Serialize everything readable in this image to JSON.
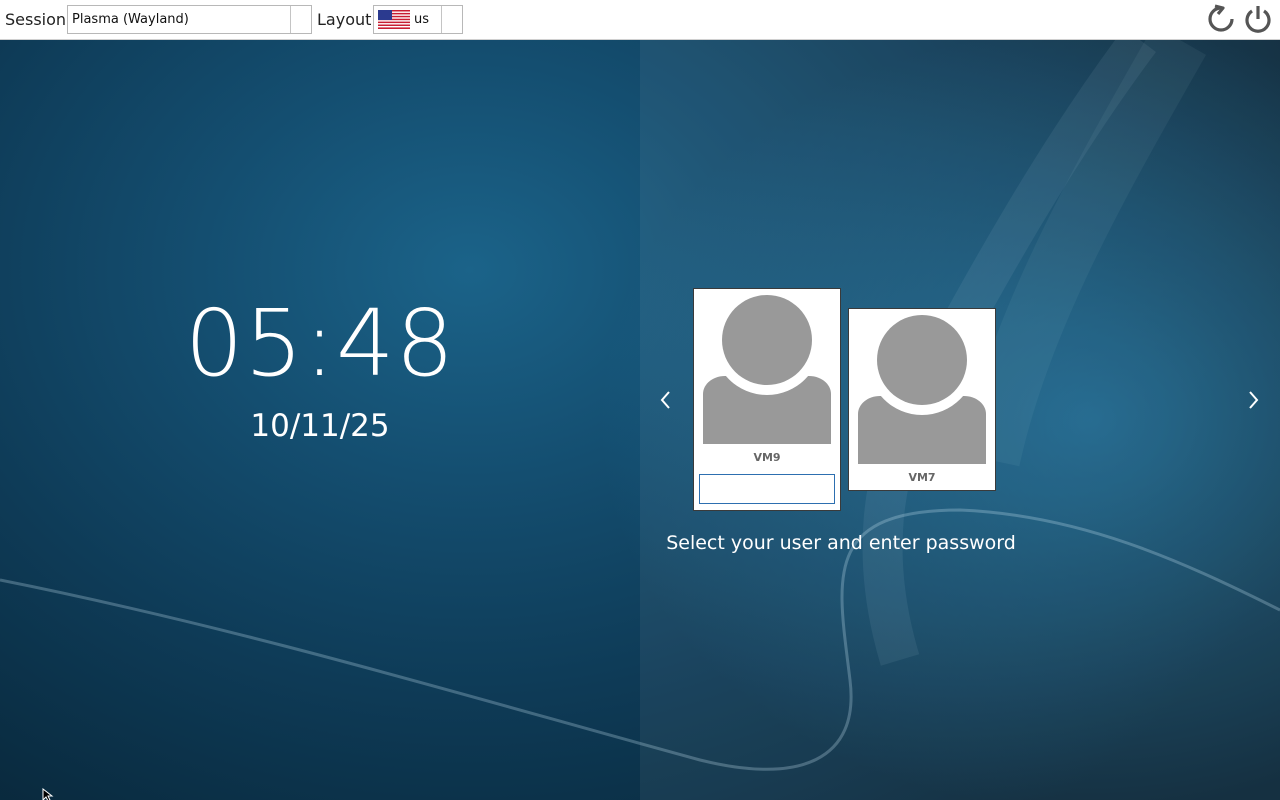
{
  "topbar": {
    "session_label": "Session",
    "session_value": "Plasma (Wayland)",
    "layout_label": "Layout",
    "layout_value": "us",
    "layout_flag": "us-flag-icon"
  },
  "clock": {
    "time": "05:48",
    "date": "10/11/25"
  },
  "users": [
    {
      "name": "VM9",
      "selected": true,
      "avatar": "user-avatar-icon"
    },
    {
      "name": "VM7",
      "selected": false,
      "avatar": "user-avatar-icon"
    }
  ],
  "password": {
    "value": "",
    "placeholder": ""
  },
  "prompt": "Select your user and enter password",
  "colors": {
    "background": "#0c3248",
    "card": "#ffffff",
    "avatar": "#999999",
    "input_border": "#2d6fb0"
  }
}
